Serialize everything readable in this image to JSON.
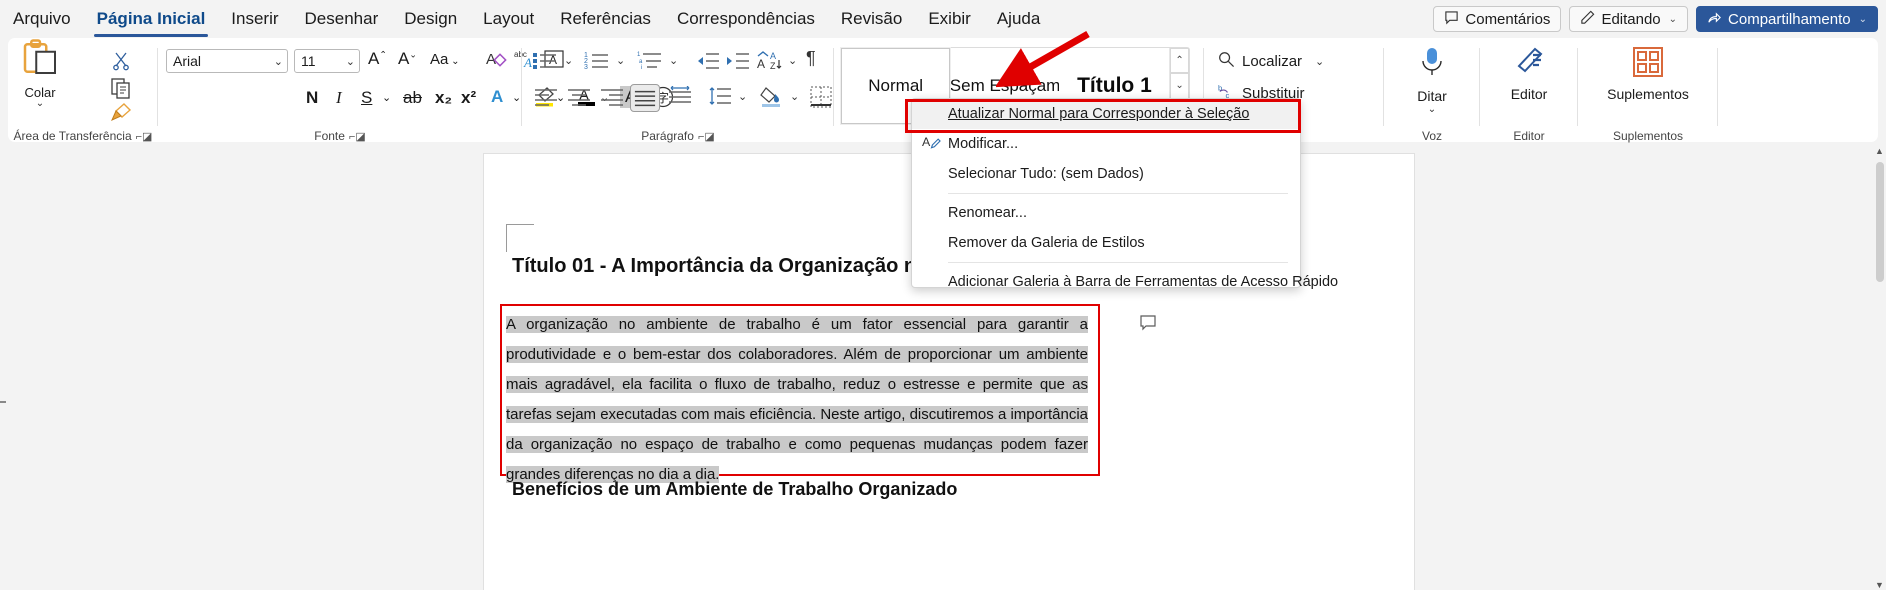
{
  "tabs": [
    {
      "label": "Arquivo",
      "active": false
    },
    {
      "label": "Página Inicial",
      "active": true
    },
    {
      "label": "Inserir",
      "active": false
    },
    {
      "label": "Desenhar",
      "active": false
    },
    {
      "label": "Design",
      "active": false
    },
    {
      "label": "Layout",
      "active": false
    },
    {
      "label": "Referências",
      "active": false
    },
    {
      "label": "Correspondências",
      "active": false
    },
    {
      "label": "Revisão",
      "active": false
    },
    {
      "label": "Exibir",
      "active": false
    },
    {
      "label": "Ajuda",
      "active": false
    }
  ],
  "titlebar_right": {
    "comments": "Comentários",
    "editing": "Editando",
    "share": "Compartilhamento",
    "share_color": "#2b579a",
    "caret": "⌄"
  },
  "ribbon": {
    "groups": [
      {
        "name": "clipboard",
        "label": "Área de Transferência",
        "has_launcher": true
      },
      {
        "name": "font",
        "label": "Fonte",
        "has_launcher": true
      },
      {
        "name": "paragraph",
        "label": "Parágrafo",
        "has_launcher": true
      },
      {
        "name": "styles",
        "label": "",
        "has_launcher": false
      },
      {
        "name": "editing",
        "label": "",
        "has_launcher": false
      },
      {
        "name": "voice",
        "label": "Voz",
        "has_launcher": false
      },
      {
        "name": "editor",
        "label": "Editor",
        "has_launcher": false
      },
      {
        "name": "addins",
        "label": "Suplementos",
        "has_launcher": false
      }
    ],
    "clipboard": {
      "paste_label": "Colar",
      "cut_icon": "scissors-icon",
      "copy_icon": "copy-icon",
      "format_painter_icon": "format-painter-icon"
    },
    "font": {
      "font_family_value": "Arial",
      "font_size_value": "11",
      "grow_font": "A",
      "shrink_font": "A",
      "change_case": "Aa",
      "clear_formatting": "A",
      "phonetic": "abc",
      "char_border": "A",
      "bold": "N",
      "italic": "I",
      "underline": "S",
      "strikethrough": "ab",
      "subscript": "x₂",
      "superscript": "x²",
      "text_effects": "A",
      "highlight": "A",
      "font_color": "A",
      "shading": "A",
      "char_enclose": "字"
    },
    "paragraph": {
      "bullets": "bullet-list-icon",
      "numbering": "numbered-list-icon",
      "multilevel": "multilevel-list-icon",
      "decrease_indent": "decrease-indent-icon",
      "increase_indent": "increase-indent-icon",
      "sort": "sort-icon",
      "show_marks": "¶",
      "align_left": "align-left-icon",
      "align_center": "align-center-icon",
      "align_right": "align-right-icon",
      "justify": "justify-icon",
      "line_spacing": "line-spacing-icon",
      "shading": "shading-icon",
      "borders": "borders-icon"
    },
    "styles": {
      "tiles": [
        {
          "label": "Normal",
          "selected": true,
          "heading": false
        },
        {
          "label": "Sem Espaçam",
          "selected": false,
          "heading": false
        },
        {
          "label": "Título 1",
          "selected": false,
          "heading": true
        }
      ],
      "scroll_up": "⌃",
      "scroll_down": "⌄",
      "more": "⌄"
    },
    "editing": {
      "find": "Localizar",
      "replace": "Substituir",
      "find_caret": "⌄"
    },
    "voice": {
      "dictate": "Ditar",
      "caret": "⌄"
    },
    "editor": {
      "editor": "Editor"
    },
    "addins": {
      "addins": "Suplementos"
    }
  },
  "context_menu": {
    "highlighted_index": 0,
    "items": [
      {
        "label": "Atualizar Normal para Corresponder à Seleção",
        "accel": "A",
        "icon": "",
        "highlighted": true,
        "separator_after": false
      },
      {
        "label": "Modificar...",
        "accel": "M",
        "icon": "modify-style-icon",
        "highlighted": false,
        "separator_after": false
      },
      {
        "label": "Selecionar Tudo: (sem Dados)",
        "accel": "S",
        "icon": "",
        "highlighted": false,
        "separator_after": true
      },
      {
        "label": "Renomear...",
        "accel": "n",
        "icon": "",
        "highlighted": false,
        "separator_after": false
      },
      {
        "label": "Remover da Galeria de Estilos",
        "accel": "G",
        "icon": "",
        "highlighted": false,
        "separator_after": true
      },
      {
        "label": "Adicionar Galeria à Barra de Ferramentas de Acesso Rápido",
        "accel": "G",
        "icon": "",
        "highlighted": false,
        "separator_after": false
      }
    ]
  },
  "document": {
    "heading1": "Título 01 - A Importância da Organização no Ambiente de Trabalho",
    "paragraph": "A organização no ambiente de trabalho é um fator essencial para garantir a produtividade e o bem-estar dos colaboradores. Além de proporcionar um ambiente mais agradável, ela facilita o fluxo de trabalho, reduz o estresse e permite que as tarefas sejam executadas com mais eficiência. Neste artigo, discutiremos a importância da organização no espaço de trabalho e como pequenas mudanças podem fazer grandes diferenças no dia a dia.",
    "heading2": "Benefícios de um Ambiente de Trabalho Organizado",
    "selection_highlight_color": "#c9c9c9",
    "annotation_color": "#e00000",
    "comment_marker": "comment-icon"
  }
}
